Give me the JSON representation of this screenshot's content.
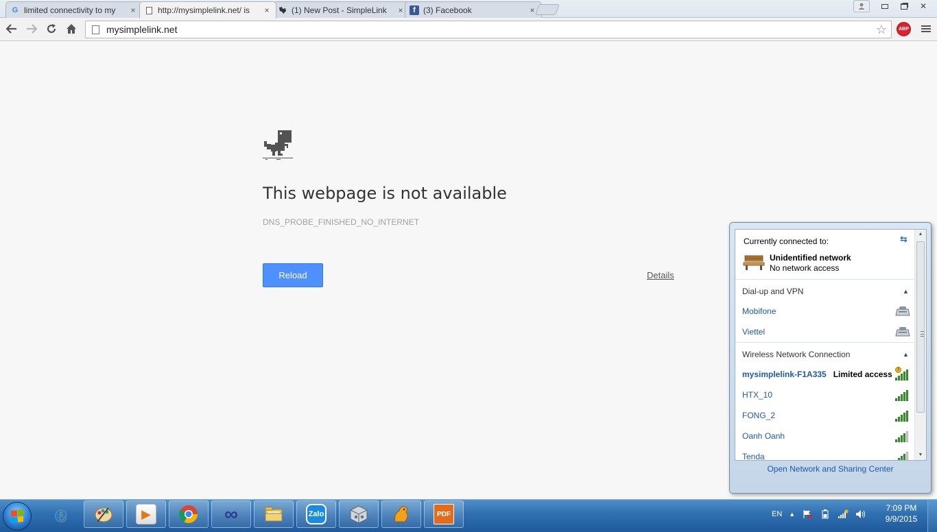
{
  "browser": {
    "tabs": [
      {
        "title": "limited connectivity to my",
        "favicon": "google-icon",
        "active": false
      },
      {
        "title": "http://mysimplelink.net/ is",
        "favicon": "page-icon",
        "active": true
      },
      {
        "title": "(1) New Post - SimpleLink",
        "favicon": "ti-icon",
        "active": false
      },
      {
        "title": "(3) Facebook",
        "favicon": "facebook-icon",
        "active": false
      }
    ],
    "close_glyph": "×",
    "address": "mysimplelink.net",
    "abp_label": "ABP"
  },
  "error_page": {
    "title": "This webpage is not available",
    "code": "DNS_PROBE_FINISHED_NO_INTERNET",
    "reload_label": "Reload",
    "details_label": "Details"
  },
  "network_flyout": {
    "header": "Currently connected to:",
    "current": {
      "name": "Unidentified network",
      "status": "No network access"
    },
    "dialup_section": "Dial-up and VPN",
    "dialup": [
      {
        "name": "Mobifone"
      },
      {
        "name": "Viettel"
      }
    ],
    "wireless_section": "Wireless Network Connection",
    "wireless": [
      {
        "name": "mysimplelink-F1A335",
        "status": "Limited access",
        "signal": 5,
        "warning": true
      },
      {
        "name": "HTX_10",
        "status": "",
        "signal": 5,
        "warning": false
      },
      {
        "name": "FONG_2",
        "status": "",
        "signal": 5,
        "warning": false
      },
      {
        "name": "Oanh Oanh",
        "status": "",
        "signal": 4,
        "warning": false
      },
      {
        "name": "Tenda",
        "status": "",
        "signal": 4,
        "warning": false
      }
    ],
    "footer_link": "Open Network and Sharing Center"
  },
  "taskbar": {
    "apps": [
      {
        "name": "internet-explorer-icon",
        "label": "e",
        "color": "#1f7bd4"
      },
      {
        "name": "paint-icon",
        "label": "",
        "color": "#d9a14a"
      },
      {
        "name": "media-player-icon",
        "label": "▶",
        "color": "#e07a1c"
      },
      {
        "name": "chrome-icon",
        "label": "",
        "color": "#ffffff"
      },
      {
        "name": "infinity-app-icon",
        "label": "∞",
        "color": "#2b3f8f"
      },
      {
        "name": "file-explorer-icon",
        "label": "",
        "color": "#e8c45a"
      },
      {
        "name": "zalo-icon",
        "label": "Zalo",
        "color": "#1b8ae0"
      },
      {
        "name": "cube-app-icon",
        "label": "",
        "color": "#cfd6de"
      },
      {
        "name": "squirrel-app-icon",
        "label": "",
        "color": "#f0a21c"
      },
      {
        "name": "pdf-app-icon",
        "label": "PDF",
        "color": "#e46b1b"
      }
    ],
    "language": "EN",
    "time": "7:09 PM",
    "date": "9/9/2015"
  },
  "colors": {
    "reload_button": "#4d90fe",
    "link_blue": "#1d5aa8",
    "taskbar": "#2f6fb0",
    "signal_green": "#3aa32d"
  }
}
